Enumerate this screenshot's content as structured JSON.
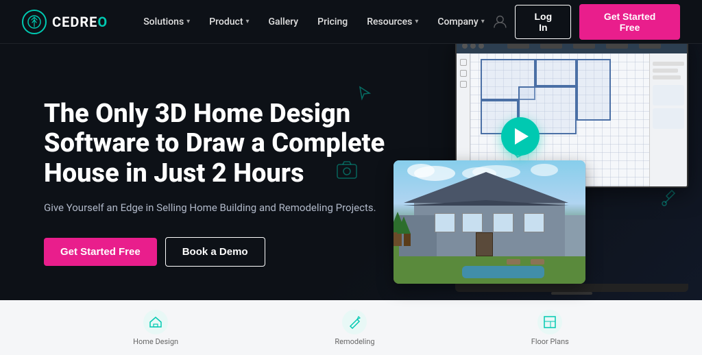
{
  "brand": {
    "name_main": "CEDREO",
    "name_highlight": "O",
    "logo_symbol": "🌲"
  },
  "nav": {
    "links": [
      {
        "label": "Solutions",
        "has_dropdown": true
      },
      {
        "label": "Product",
        "has_dropdown": true
      },
      {
        "label": "Gallery",
        "has_dropdown": false
      },
      {
        "label": "Pricing",
        "has_dropdown": false
      },
      {
        "label": "Resources",
        "has_dropdown": true
      },
      {
        "label": "Company",
        "has_dropdown": true
      }
    ],
    "login_label": "Log In",
    "cta_label": "Get Started Free"
  },
  "hero": {
    "title": "The Only 3D Home Design Software to Draw a Complete House in Just 2 Hours",
    "subtitle": "Give Yourself an Edge in Selling Home Building and Remodeling Projects.",
    "cta_button": "Get Started Free",
    "demo_button": "Book a Demo"
  },
  "bottom_strip": {
    "items": [
      {
        "icon": "🏠",
        "label": "Home Design"
      },
      {
        "icon": "🔧",
        "label": "Remodeling"
      },
      {
        "icon": "📐",
        "label": "Floor Plans"
      }
    ]
  }
}
